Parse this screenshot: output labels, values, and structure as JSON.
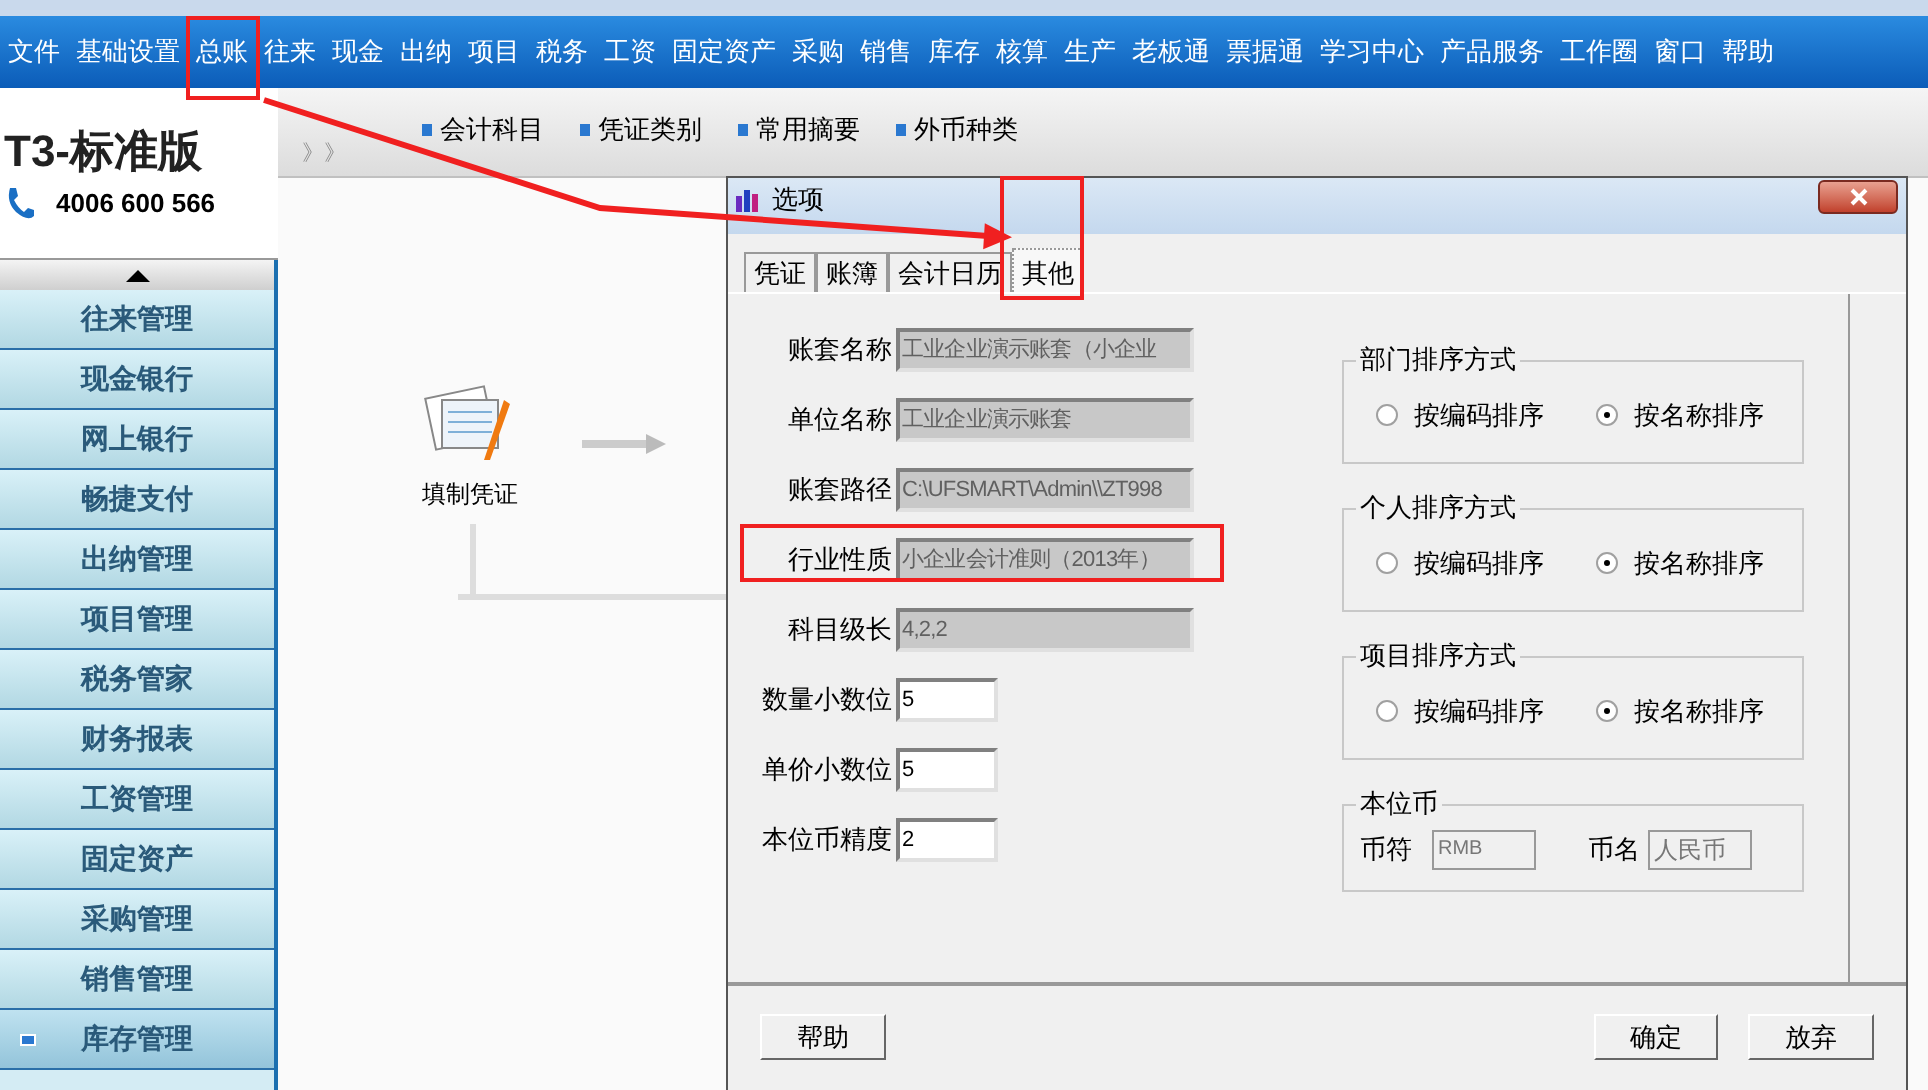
{
  "menu_bar": [
    "文件",
    "基础设置",
    "总账",
    "往来",
    "现金",
    "出纳",
    "项目",
    "税务",
    "工资",
    "固定资产",
    "采购",
    "销售",
    "库存",
    "核算",
    "生产",
    "老板通",
    "票据通",
    "学习中心",
    "产品服务",
    "工作圈",
    "窗口",
    "帮助"
  ],
  "logo": {
    "brand": "T3-标准版",
    "phone": "4006 600 566"
  },
  "toolbar": {
    "expander": "》》",
    "links": [
      "会计科目",
      "凭证类别",
      "常用摘要",
      "外币种类"
    ]
  },
  "sidebar": {
    "items": [
      {
        "label": "往来管理",
        "selected": false
      },
      {
        "label": "现金银行",
        "selected": false
      },
      {
        "label": "网上银行",
        "selected": false
      },
      {
        "label": "畅捷支付",
        "selected": false
      },
      {
        "label": "出纳管理",
        "selected": false
      },
      {
        "label": "项目管理",
        "selected": false
      },
      {
        "label": "税务管家",
        "selected": false
      },
      {
        "label": "财务报表",
        "selected": false
      },
      {
        "label": "工资管理",
        "selected": false
      },
      {
        "label": "固定资产",
        "selected": false
      },
      {
        "label": "采购管理",
        "selected": false
      },
      {
        "label": "销售管理",
        "selected": false
      },
      {
        "label": "库存管理",
        "selected": true
      }
    ]
  },
  "flow": {
    "node_label": "填制凭证"
  },
  "dialog": {
    "title": "选项",
    "tabs": [
      {
        "label": "凭证",
        "selected": false
      },
      {
        "label": "账簿",
        "selected": false
      },
      {
        "label": "会计日历",
        "selected": false
      },
      {
        "label": "其他",
        "selected": true
      }
    ],
    "fields": [
      {
        "label": "账套名称",
        "value": "工业企业演示账套（小企业",
        "disabled": true,
        "kind": "wide"
      },
      {
        "label": "单位名称",
        "value": "工业企业演示账套",
        "disabled": true,
        "kind": "wide"
      },
      {
        "label": "账套路径",
        "value": "C:\\UFSMART\\Admin\\\\ZT998",
        "disabled": true,
        "kind": "wide"
      },
      {
        "label": "行业性质",
        "value": "小企业会计准则（2013年）",
        "disabled": true,
        "kind": "wide"
      },
      {
        "label": "科目级长",
        "value": "4,2,2",
        "disabled": true,
        "kind": "wide"
      },
      {
        "label": "数量小数位",
        "value": "5",
        "disabled": false,
        "kind": "narrow"
      },
      {
        "label": "单价小数位",
        "value": "5",
        "disabled": false,
        "kind": "narrow"
      },
      {
        "label": "本位币精度",
        "value": "2",
        "disabled": false,
        "kind": "narrow"
      }
    ],
    "sort_groups": [
      {
        "title": "部门排序方式",
        "options": [
          {
            "label": "按编码排序",
            "selected": false
          },
          {
            "label": "按名称排序",
            "selected": true
          }
        ]
      },
      {
        "title": "个人排序方式",
        "options": [
          {
            "label": "按编码排序",
            "selected": false
          },
          {
            "label": "按名称排序",
            "selected": true
          }
        ]
      },
      {
        "title": "项目排序方式",
        "options": [
          {
            "label": "按编码排序",
            "selected": false
          },
          {
            "label": "按名称排序",
            "selected": true
          }
        ]
      }
    ],
    "currency": {
      "title": "本位币",
      "symbol_label": "币符",
      "symbol": "RMB",
      "name_label": "币名",
      "name": "人民币"
    },
    "buttons": {
      "help": "帮助",
      "ok": "确定",
      "cancel": "放弃"
    }
  }
}
